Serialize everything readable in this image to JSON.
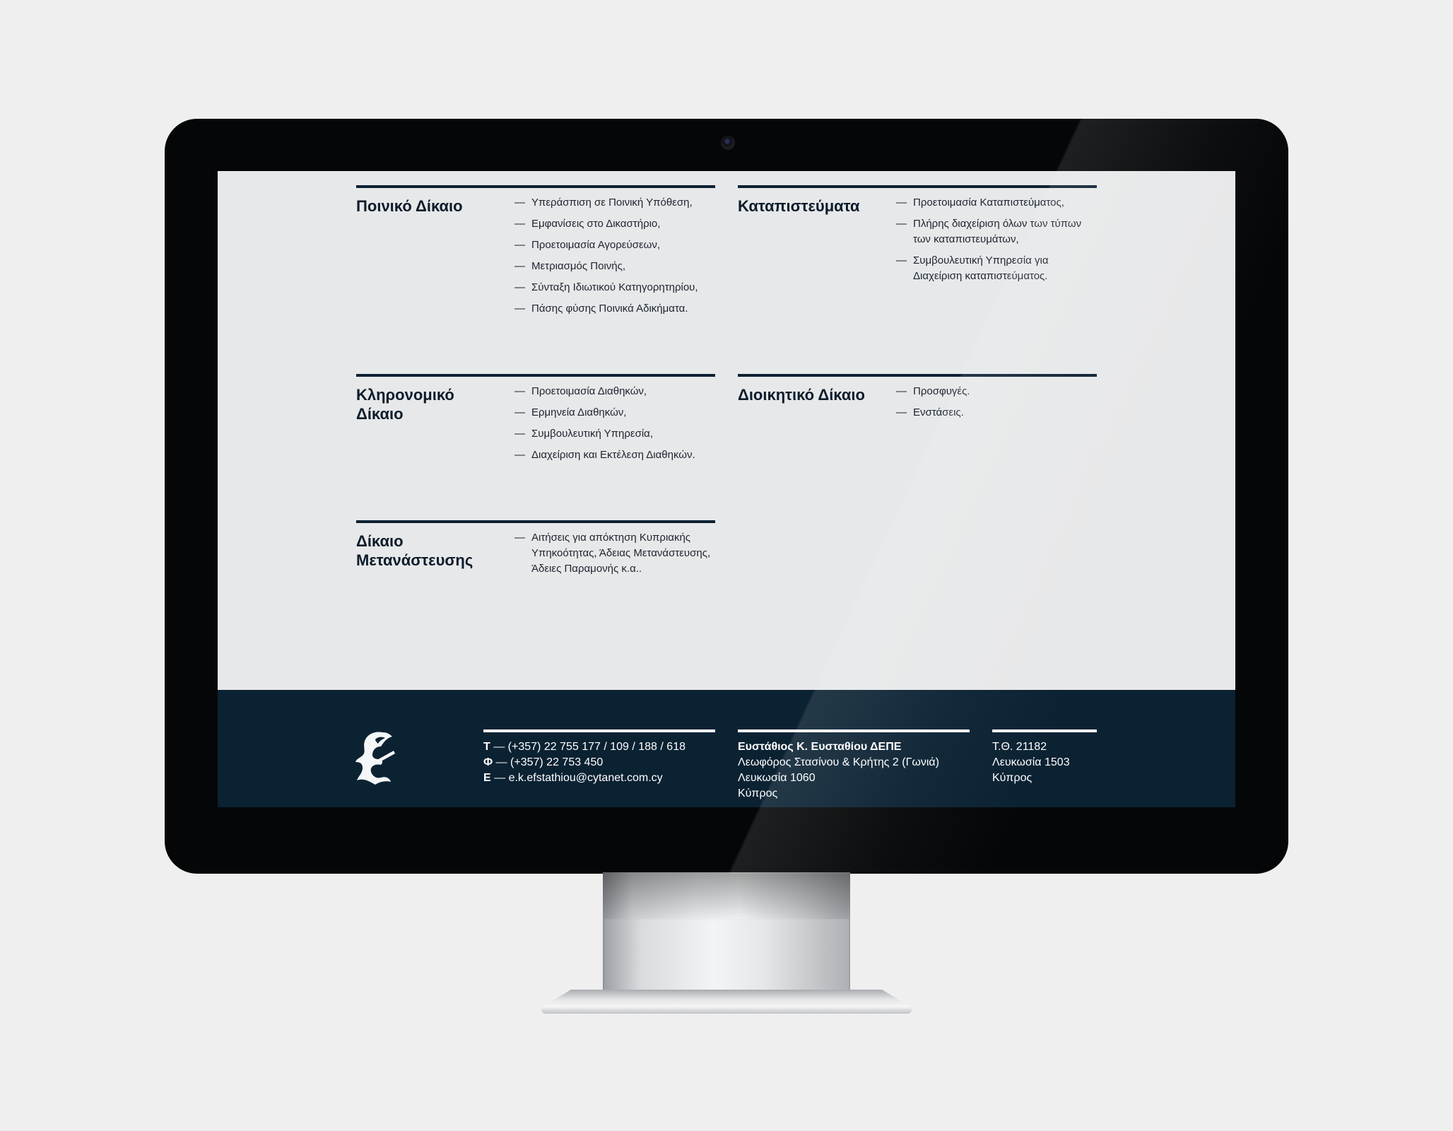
{
  "practices": [
    {
      "title": "Ποινικό Δίκαιο",
      "items": [
        "Υπεράσπιση σε Ποινική Υπόθεση,",
        "Εμφανίσεις στο Δικαστήριο,",
        "Προετοιμασία Αγορεύσεων,",
        "Μετριασμός Ποινής,",
        "Σύνταξη Ιδιωτικού Κατηγορητηρίου,",
        "Πάσης φύσης Ποινικά Αδικήματα."
      ]
    },
    {
      "title": "Καταπιστεύματα",
      "items": [
        "Προετοιμασία Καταπιστεύματος,",
        "Πλήρης διαχείριση όλων των τύπων των καταπιστευμάτων,",
        "Συμβουλευτική Υπηρεσία για Διαχείριση καταπιστεύματος."
      ]
    },
    {
      "title": "Κληρονομικό Δίκαιο",
      "items": [
        "Προετοιμασία Διαθηκών,",
        "Ερμηνεία Διαθηκών,",
        "Συμβουλευτική Υπηρεσία,",
        "Διαχείριση και Εκτέλεση Διαθηκών."
      ]
    },
    {
      "title": "Διοικητικό Δίκαιο",
      "items": [
        "Προσφυγές.",
        "Ενστάσεις."
      ]
    },
    {
      "title": "Δίκαιο Μετανάστευσης",
      "items": [
        "Αιτήσεις για απόκτηση Κυπριακής Υπηκοότητας, Άδειας Μετανάστευσης, Άδειες Παραμονής κ.α.."
      ]
    }
  ],
  "bullet": "—",
  "footer": {
    "contacts": [
      {
        "key": "Τ",
        "sep": " — ",
        "value": "(+357) 22 755 177 / 109 / 188 / 618"
      },
      {
        "key": "Φ",
        "sep": " — ",
        "value": "(+357) 22 753 450"
      },
      {
        "key": "Ε",
        "sep": " — ",
        "value": "e.k.efstathiou@cytanet.com.cy"
      }
    ],
    "company": "Ευστάθιος Κ. Ευσταθίου ΔΕΠΕ",
    "address": [
      "Λεωφόρος Στασίνου & Κρήτης 2 (Γωνιά)",
      "Λευκωσία 1060",
      "Κύπρος"
    ],
    "po_box": [
      "Τ.Θ. 21182",
      "Λευκωσία 1503",
      "Κύπρος"
    ]
  },
  "colors": {
    "background": "#efefef",
    "screen": "#e7e8e9",
    "navy": "#0b2233",
    "bezel": "#050607"
  },
  "icons": {
    "logo": "blackletter-e-logo",
    "camera": "camera-icon"
  }
}
